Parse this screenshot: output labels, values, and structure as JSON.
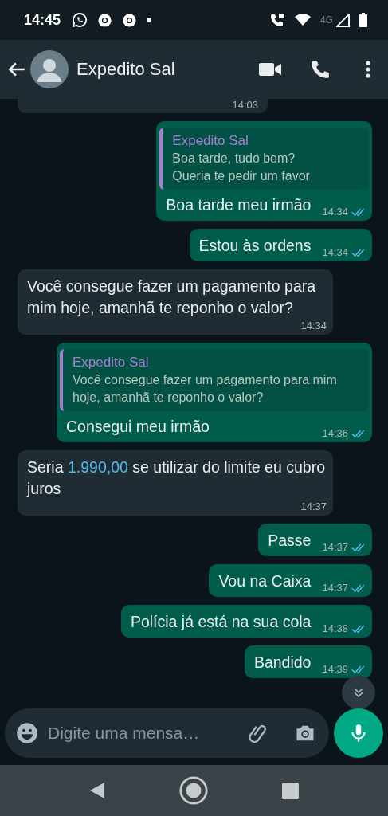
{
  "status_bar": {
    "time": "14:45",
    "network_label": "4G"
  },
  "header": {
    "contact_name": "Expedito Sal"
  },
  "messages": [
    {
      "kind": "cut",
      "time": "14:03"
    },
    {
      "kind": "outgoing",
      "quote": {
        "author": "Expedito Sal",
        "text": "Boa tarde, tudo bem?\nQueria te pedir um favor"
      },
      "segments": [
        {
          "kind": "plain",
          "text": "Boa tarde meu irmão"
        }
      ],
      "time": "14:34",
      "read": true
    },
    {
      "kind": "outgoing",
      "segments": [
        {
          "kind": "plain",
          "text": "Estou às ordens"
        }
      ],
      "time": "14:34",
      "read": true
    },
    {
      "kind": "incoming",
      "segments": [
        {
          "kind": "plain",
          "text": "Você consegue fazer um pagamento para mim hoje, amanhã te reponho o valor?"
        }
      ],
      "time": "14:34"
    },
    {
      "kind": "outgoing",
      "quote": {
        "author": "Expedito Sal",
        "text": "Você consegue fazer um pagamento para mim hoje, amanhã te reponho o valor?"
      },
      "segments": [
        {
          "kind": "plain",
          "text": "Consegui meu irmão"
        }
      ],
      "time": "14:36",
      "read": true
    },
    {
      "kind": "incoming",
      "segments": [
        {
          "kind": "plain",
          "text": "Seria "
        },
        {
          "kind": "link",
          "text": "1.990,00"
        },
        {
          "kind": "plain",
          "text": " se utilizar do limite eu cubro juros"
        }
      ],
      "time": "14:37"
    },
    {
      "kind": "outgoing",
      "segments": [
        {
          "kind": "plain",
          "text": "Passe"
        }
      ],
      "time": "14:37",
      "read": true
    },
    {
      "kind": "outgoing",
      "segments": [
        {
          "kind": "plain",
          "text": "Vou na Caixa"
        }
      ],
      "time": "14:37",
      "read": true
    },
    {
      "kind": "outgoing",
      "segments": [
        {
          "kind": "plain",
          "text": "Polícia já está na sua cola"
        }
      ],
      "time": "14:38",
      "read": true
    },
    {
      "kind": "outgoing",
      "segments": [
        {
          "kind": "plain",
          "text": "Bandido"
        }
      ],
      "time": "14:39",
      "read": true
    }
  ],
  "composer": {
    "placeholder": "Digite uma mensa…"
  }
}
